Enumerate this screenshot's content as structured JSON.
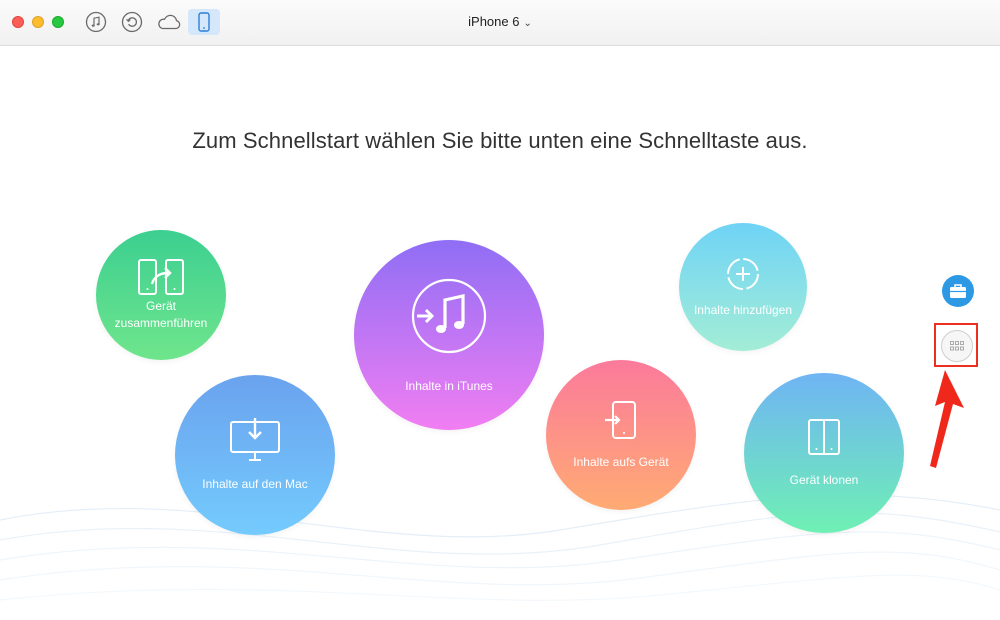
{
  "titlebar": {
    "device_name": "iPhone 6",
    "chevron": "⌄",
    "toolbar_icons": [
      "music-icon",
      "history-icon",
      "cloud-icon",
      "iphone-icon"
    ]
  },
  "headline": "Zum Schnellstart wählen Sie bitte unten eine Schnelltaste aus.",
  "shortcuts": {
    "merge": {
      "label_line1": "Gerät",
      "label_line2": "zusammenführen",
      "icon": "merge-devices-icon"
    },
    "mac": {
      "label": "Inhalte auf den Mac",
      "icon": "download-to-mac-icon"
    },
    "itunes": {
      "label": "Inhalte in iTunes",
      "icon": "itunes-icon"
    },
    "device": {
      "label": "Inhalte aufs Gerät",
      "icon": "transfer-to-device-icon"
    },
    "add": {
      "label": "Inhalte hinzufügen",
      "icon": "add-content-icon"
    },
    "clone": {
      "label": "Gerät klonen",
      "icon": "clone-device-icon"
    }
  },
  "side_buttons": [
    "toolbox-icon",
    "grid-icon"
  ],
  "colors": {
    "accent_blue": "#2d98e4",
    "highlight_red": "#ef2e22"
  }
}
